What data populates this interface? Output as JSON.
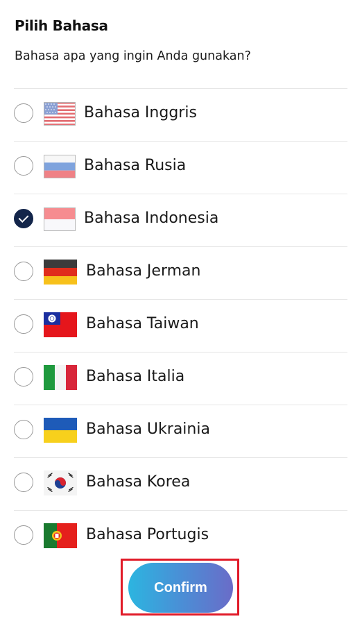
{
  "header": {
    "title": "Pilih Bahasa",
    "subtitle": "Bahasa apa yang ingin Anda gunakan?"
  },
  "languages": [
    {
      "label": "Bahasa Inggris",
      "flag": "us-flag-icon",
      "selected": false
    },
    {
      "label": "Bahasa Rusia",
      "flag": "russia-flag-icon",
      "selected": false
    },
    {
      "label": "Bahasa Indonesia",
      "flag": "indonesia-flag-icon",
      "selected": true
    },
    {
      "label": "Bahasa Jerman",
      "flag": "germany-flag-icon",
      "selected": false
    },
    {
      "label": "Bahasa Taiwan",
      "flag": "taiwan-flag-icon",
      "selected": false
    },
    {
      "label": "Bahasa Italia",
      "flag": "italy-flag-icon",
      "selected": false
    },
    {
      "label": "Bahasa Ukrainia",
      "flag": "ukraine-flag-icon",
      "selected": false
    },
    {
      "label": "Bahasa Korea",
      "flag": "korea-flag-icon",
      "selected": false
    },
    {
      "label": "Bahasa Portugis",
      "flag": "portugal-flag-icon",
      "selected": false
    }
  ],
  "footer": {
    "confirm_label": "Confirm"
  },
  "colors": {
    "selected_radio": "#13254a",
    "button_gradient_start": "#2cb5e0",
    "button_gradient_end": "#6a6cc8",
    "highlight_border": "#e11a28"
  }
}
